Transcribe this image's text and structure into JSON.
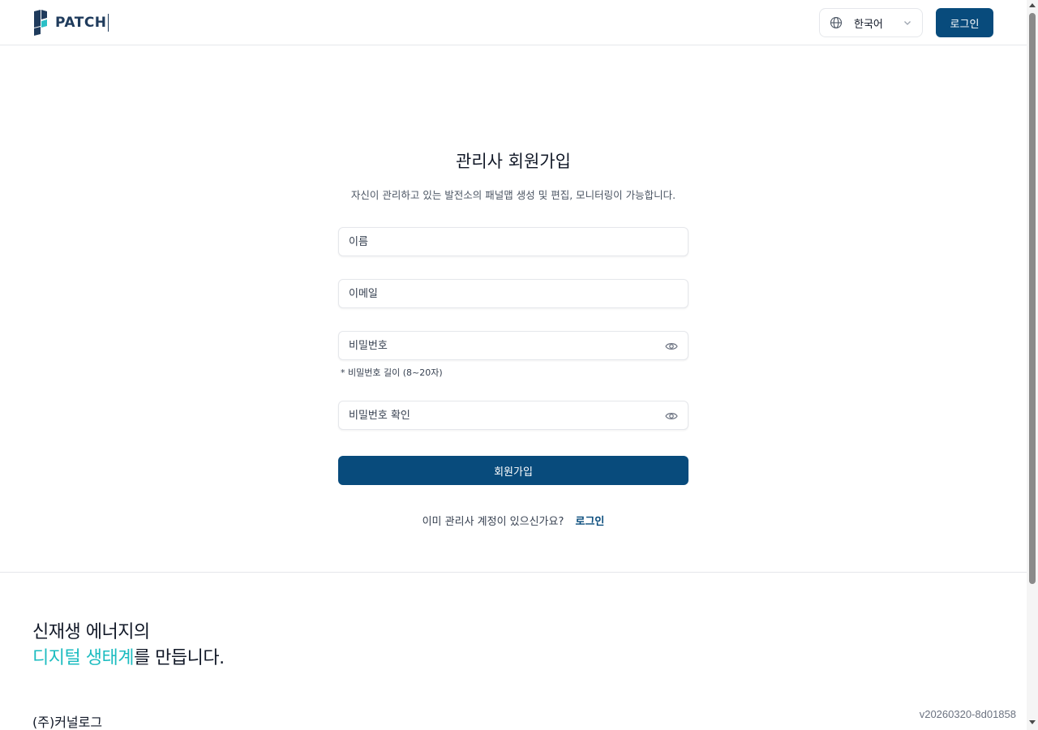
{
  "header": {
    "logo_text": "PATCH",
    "language": {
      "selected": "한국어"
    },
    "login_button": "로그인"
  },
  "form": {
    "title": "관리사 회원가입",
    "subtitle": "자신이 관리하고 있는 발전소의 패널맵 생성 및 편집, 모니터링이 가능합니다.",
    "name_placeholder": "이름",
    "email_placeholder": "이메일",
    "password_placeholder": "비밀번호",
    "password_hint": "* 비밀번호 길이 (8~20자)",
    "password_confirm_placeholder": "비밀번호 확인",
    "submit_label": "회원가입",
    "login_prompt": "이미 관리사 계정이 있으신가요?",
    "login_link": "로그인"
  },
  "footer": {
    "slogan_line1": "신재생 에너지의",
    "slogan_accent": "디지털 생태계",
    "slogan_rest": "를 만듭니다.",
    "company": "(주)커널로그",
    "version": "v20260320-8d01858"
  },
  "colors": {
    "primary": "#084b7c",
    "accent": "#1cbcc0",
    "logo_dark": "#1f3b5c",
    "logo_teal": "#2bbfc6"
  },
  "icons": {
    "language": "globe-icon",
    "dropdown": "chevron-down-icon",
    "password_toggle": "eye-icon"
  }
}
